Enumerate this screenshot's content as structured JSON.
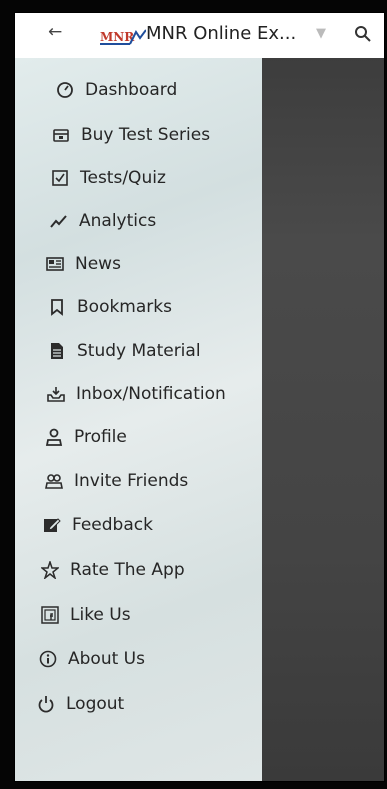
{
  "appbar": {
    "back_icon": "back-arrow-icon",
    "logo_text": "MNR",
    "title": "MNR Online Ex...",
    "filter_icon": "filter-icon",
    "search_icon": "search-icon"
  },
  "drawer": {
    "items": [
      {
        "label": "Dashboard",
        "icon": "dashboard-icon"
      },
      {
        "label": "Buy Test Series",
        "icon": "cart-icon"
      },
      {
        "label": "Tests/Quiz",
        "icon": "quiz-icon"
      },
      {
        "label": "Analytics",
        "icon": "analytics-icon"
      },
      {
        "label": "News",
        "icon": "news-icon"
      },
      {
        "label": "Bookmarks",
        "icon": "bookmark-icon"
      },
      {
        "label": "Study Material",
        "icon": "document-icon"
      },
      {
        "label": "Inbox/Notification",
        "icon": "inbox-icon"
      },
      {
        "label": "Profile",
        "icon": "person-icon"
      },
      {
        "label": "Invite Friends",
        "icon": "group-icon"
      },
      {
        "label": "Feedback",
        "icon": "edit-icon"
      },
      {
        "label": "Rate The App",
        "icon": "star-icon"
      },
      {
        "label": "Like Us",
        "icon": "facebook-icon"
      },
      {
        "label": "About Us",
        "icon": "info-icon"
      },
      {
        "label": "Logout",
        "icon": "power-icon"
      }
    ]
  },
  "colors": {
    "drawer_bg": "#dfe8e8",
    "text": "#262626",
    "logo_red": "#c0392b",
    "logo_blue": "#1f4e9c"
  }
}
